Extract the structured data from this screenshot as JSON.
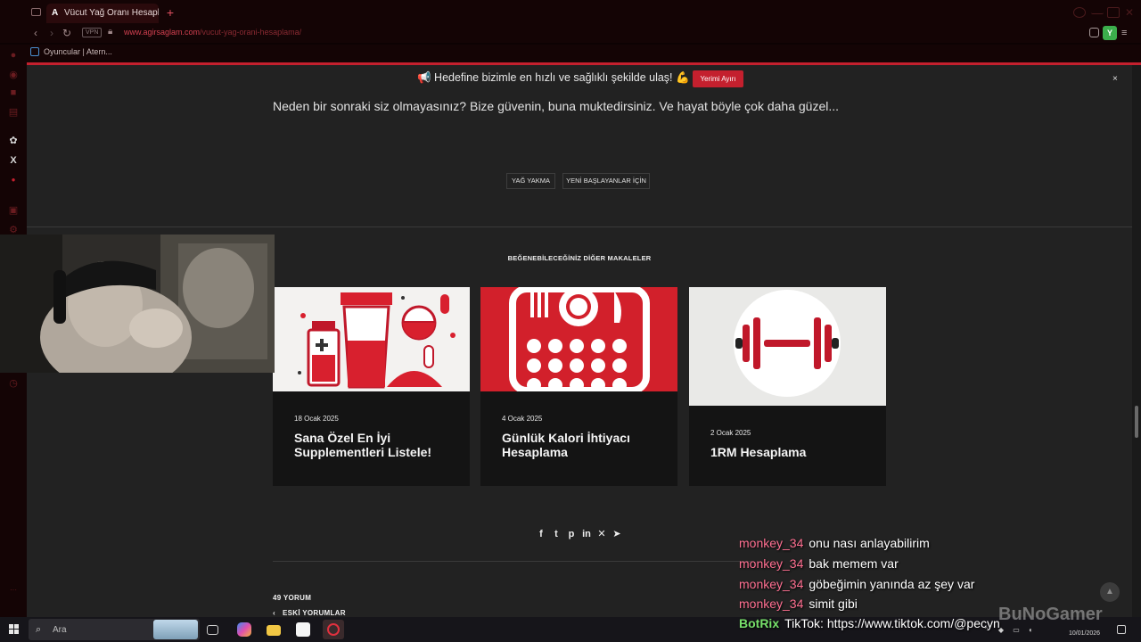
{
  "browser": {
    "tab_title": "Vücut Yağ Oranı Hesaplaya",
    "tab_favicon": "A",
    "new_tab": "+",
    "url_domain": "www.agirsaglam.com",
    "url_path": "/vucut-yag-orani-hesaplama/",
    "vpn_badge": "VPN",
    "bookmark_label": "Oyuncular | Atern...",
    "profile_initial": "Y",
    "accent": "#c4202e"
  },
  "announcement": {
    "text": "📢 Hedefine bizimle en hızlı ve sağlıklı şekilde ulaş! 💪",
    "button": "Yerimi Ayırı",
    "close": "×"
  },
  "article": {
    "intro": "Neden bir sonraki siz olmayasınız? Bize güvenin, buna muktedirsiniz. Ve hayat böyle çok daha güzel...",
    "tags": [
      "YAĞ YAKMA",
      "YENİ BAŞLAYANLAR İÇİN"
    ]
  },
  "related": {
    "heading": "BEĞENEBİLECEĞİNİZ DİĞER MAKALELER",
    "cards": [
      {
        "date": "18 Ocak 2025",
        "title": "Sana Özel En İyi Supplementleri Listele!",
        "thumb": "supplements-illustration"
      },
      {
        "date": "4 Ocak 2025",
        "title": "Günlük Kalori İhtiyacı Hesaplama",
        "thumb": "plate-calculator-illustration"
      },
      {
        "date": "2 Ocak 2025",
        "title": "1RM Hesaplama",
        "thumb": "dumbbell-illustration"
      }
    ]
  },
  "share": {
    "icons": [
      "facebook-icon",
      "twitter-icon",
      "pinterest-icon",
      "linkedin-icon",
      "xing-icon",
      "telegram-icon"
    ],
    "glyphs": [
      "f",
      "t",
      "p",
      "in",
      "✕",
      "➤"
    ]
  },
  "comments": {
    "count_label": "49 YORUM",
    "older_label": "ESKİ YORUMLAR"
  },
  "chat": {
    "lines": [
      {
        "user": "monkey_34",
        "message": "onu nası anlayabilirim"
      },
      {
        "user": "monkey_34",
        "message": "bak memem var"
      },
      {
        "user": "monkey_34",
        "message": "göbeğimin yanında az şey var"
      },
      {
        "user": "monkey_34",
        "message": "simit gibi"
      }
    ],
    "bot": {
      "user": "BotRix",
      "message": "TikTok: https://www.tiktok.com/@pecyn"
    }
  },
  "overlay": {
    "watermark": "BuNoGamer"
  },
  "taskbar": {
    "search_placeholder": "Ara",
    "date": "10/01/2026"
  }
}
